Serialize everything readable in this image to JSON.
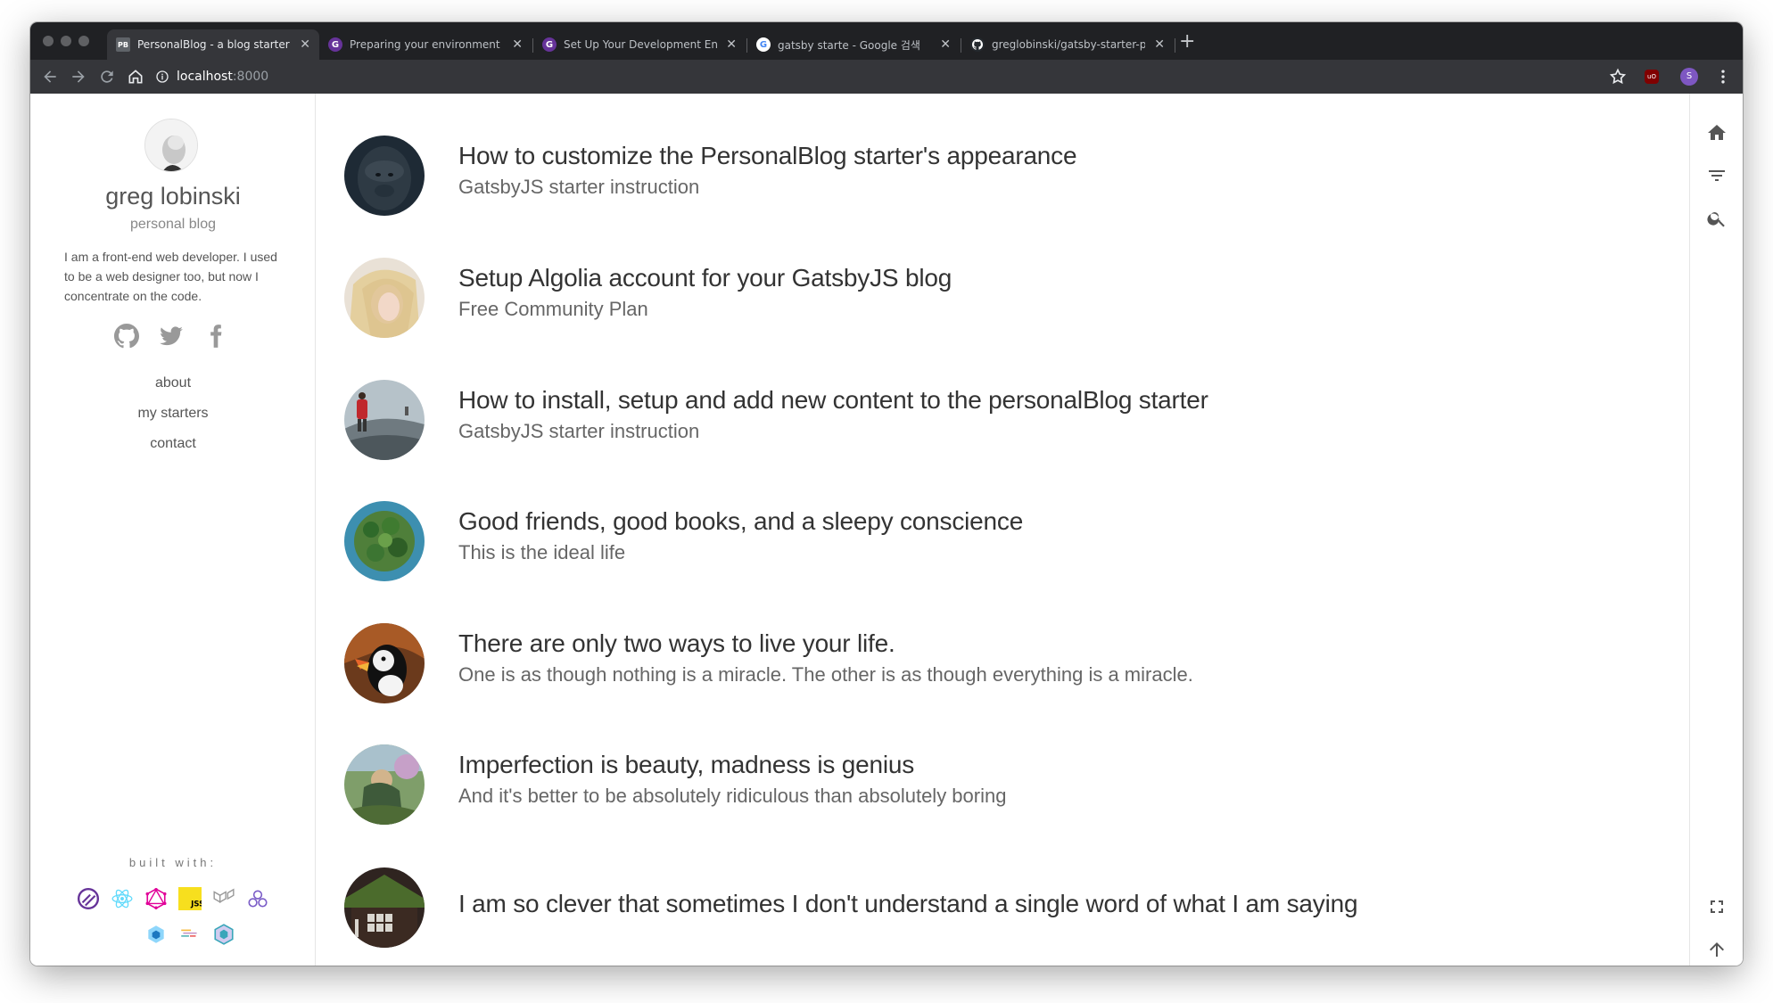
{
  "browser": {
    "tabs": [
      {
        "title": "PersonalBlog - a blog starter fo",
        "favicon": "PB",
        "active": true
      },
      {
        "title": "Preparing your environment | G",
        "favicon": "gatsby-icon",
        "active": false
      },
      {
        "title": "Set Up Your Development Envi",
        "favicon": "gatsby-icon",
        "active": false
      },
      {
        "title": "gatsby starte - Google 검색",
        "favicon": "google-icon",
        "active": false
      },
      {
        "title": "greglobinski/gatsby-starter-pe",
        "favicon": "github-icon",
        "active": false
      }
    ],
    "new_tab": "+",
    "address": {
      "host": "localhost",
      "port": ":8000"
    }
  },
  "sidebar": {
    "name": "greg lobinski",
    "subtitle": "personal blog",
    "description": "I am a front-end web developer. I used to be a web designer too, but now I concentrate on the code.",
    "social": [
      "github-icon",
      "twitter-icon",
      "facebook-icon"
    ],
    "nav": [
      "about",
      "my starters",
      "contact"
    ],
    "built_with_title": "built with:",
    "tech_icons": [
      "gatsby-icon",
      "react-icon",
      "graphql-icon",
      "jss-icon",
      "material-ui-icon",
      "apollo-icon",
      "webpack-icon",
      "prettier-icon",
      "eslint-icon"
    ]
  },
  "posts": [
    {
      "title": "How to customize the PersonalBlog starter's appearance",
      "subtitle": "GatsbyJS starter instruction",
      "thumb": "gorilla"
    },
    {
      "title": "Setup Algolia account for your GatsbyJS blog",
      "subtitle": "Free Community Plan",
      "thumb": "girl"
    },
    {
      "title": "How to install, setup and add new content to the personalBlog starter",
      "subtitle": "GatsbyJS starter instruction",
      "thumb": "hiker"
    },
    {
      "title": "Good friends, good books, and a sleepy conscience",
      "subtitle": "This is the ideal life",
      "thumb": "island"
    },
    {
      "title": "There are only two ways to live your life.",
      "subtitle": "One is as though nothing is a miracle. The other is as though everything is a miracle.",
      "thumb": "puffin"
    },
    {
      "title": "Imperfection is beauty, madness is genius",
      "subtitle": "And it's better to be absolutely ridiculous than absolutely boring",
      "thumb": "child"
    },
    {
      "title": "I am so clever that sometimes I don't understand a single word of what I am saying",
      "subtitle": "",
      "thumb": "cabin"
    }
  ],
  "actions": [
    "home-icon",
    "filter-icon",
    "search-icon",
    "fullscreen-icon",
    "arrow-up-icon"
  ],
  "colors": {
    "tabstrip": "#202124",
    "toolbar": "#35363a",
    "text": "#333333",
    "muted": "#666666"
  }
}
